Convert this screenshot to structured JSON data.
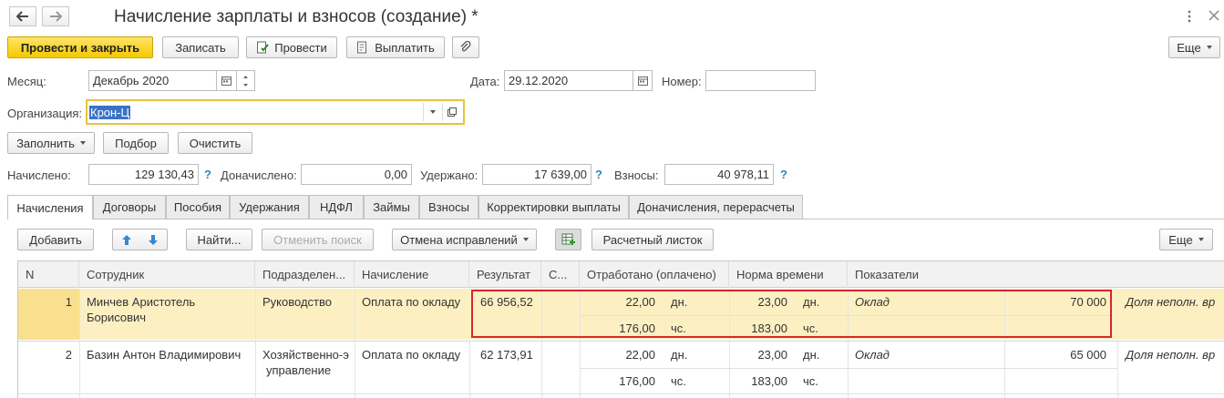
{
  "window": {
    "title": "Начисление зарплаты и взносов (создание) *"
  },
  "toolbar": {
    "post_close": "Провести и закрыть",
    "save": "Записать",
    "post": "Провести",
    "pay": "Выплатить",
    "more": "Еще"
  },
  "form": {
    "month_label": "Месяц:",
    "month_value": "Декабрь 2020",
    "date_label": "Дата:",
    "date_value": "29.12.2020",
    "number_label": "Номер:",
    "number_value": "",
    "org_label": "Организация:",
    "org_value": "Крон-Ц"
  },
  "actions": {
    "fill": "Заполнить",
    "select": "Подбор",
    "clear": "Очистить"
  },
  "totals": {
    "accrued_label": "Начислено:",
    "accrued_value": "129 130,43",
    "additional_label": "Доначислено:",
    "additional_value": "0,00",
    "withheld_label": "Удержано:",
    "withheld_value": "17 639,00",
    "contrib_label": "Взносы:",
    "contrib_value": "40 978,11",
    "help": "?"
  },
  "tabs": [
    "Начисления",
    "Договоры",
    "Пособия",
    "Удержания",
    "НДФЛ",
    "Займы",
    "Взносы",
    "Корректировки выплаты",
    "Доначисления, перерасчеты"
  ],
  "table_toolbar": {
    "add": "Добавить",
    "find": "Найти...",
    "cancel_search": "Отменить поиск",
    "cancel_corrections": "Отмена исправлений",
    "payslip": "Расчетный листок",
    "more": "Еще"
  },
  "table": {
    "headers": {
      "n": "N",
      "employee": "Сотрудник",
      "department": "Подразделен...",
      "accrual": "Начисление",
      "result": "Результат",
      "c": "С...",
      "worked": "Отработано (оплачено)",
      "norm": "Норма времени",
      "indicators": "Показатели"
    },
    "rows": [
      {
        "n": "1",
        "employee_line1": "Минчев Аристотель",
        "employee_line2": "Борисович",
        "department_line1": "Руководство",
        "department_line2": "",
        "accrual": "Оплата по окладу",
        "result": "66 956,52",
        "worked_days": "22,00",
        "worked_days_unit": "дн.",
        "worked_hours": "176,00",
        "worked_hours_unit": "чс.",
        "norm_days": "23,00",
        "norm_days_unit": "дн.",
        "norm_hours": "183,00",
        "norm_hours_unit": "чс.",
        "indicator_name": "Оклад",
        "indicator_value": "70 000",
        "indicator2": "Доля неполн. вр"
      },
      {
        "n": "2",
        "employee_line1": "Базин Антон Владимирович",
        "employee_line2": "",
        "department_line1": "Хозяйственно-э",
        "department_line2": "управление",
        "accrual": "Оплата по окладу",
        "result": "62 173,91",
        "worked_days": "22,00",
        "worked_days_unit": "дн.",
        "worked_hours": "176,00",
        "worked_hours_unit": "чс.",
        "norm_days": "23,00",
        "norm_days_unit": "дн.",
        "norm_hours": "183,00",
        "norm_hours_unit": "чс.",
        "indicator_name": "Оклад",
        "indicator_value": "65 000",
        "indicator2": "Доля неполн. вр"
      }
    ]
  },
  "colors": {
    "primary_button": "#f5c800",
    "selected_row": "#fcf0c3",
    "highlight_frame": "#d9262c",
    "help_icon": "#2e86c1",
    "focus_border": "#e8c23a"
  }
}
